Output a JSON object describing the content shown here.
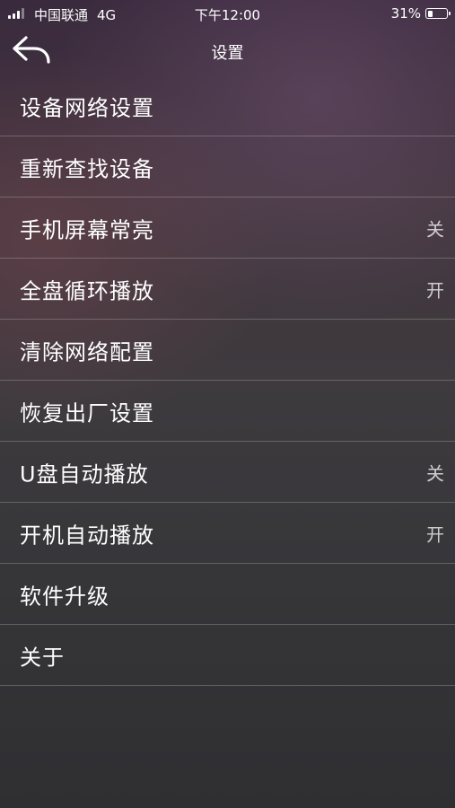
{
  "status_bar": {
    "carrier": "中国联通",
    "network": "4G",
    "time": "下午12:00",
    "battery_percent": "31%",
    "battery_level": 0.31
  },
  "nav": {
    "back_icon": "back-arrow-icon",
    "title": "设置"
  },
  "menu": {
    "items": [
      {
        "label": "设备网络设置",
        "value": ""
      },
      {
        "label": "重新查找设备",
        "value": ""
      },
      {
        "label": "手机屏幕常亮",
        "value": "关"
      },
      {
        "label": "全盘循环播放",
        "value": "开"
      },
      {
        "label": "清除网络配置",
        "value": ""
      },
      {
        "label": "恢复出厂设置",
        "value": ""
      },
      {
        "label": "U盘自动播放",
        "value": "关"
      },
      {
        "label": "开机自动播放",
        "value": "开"
      },
      {
        "label": "软件升级",
        "value": ""
      },
      {
        "label": "关于",
        "value": ""
      }
    ]
  }
}
